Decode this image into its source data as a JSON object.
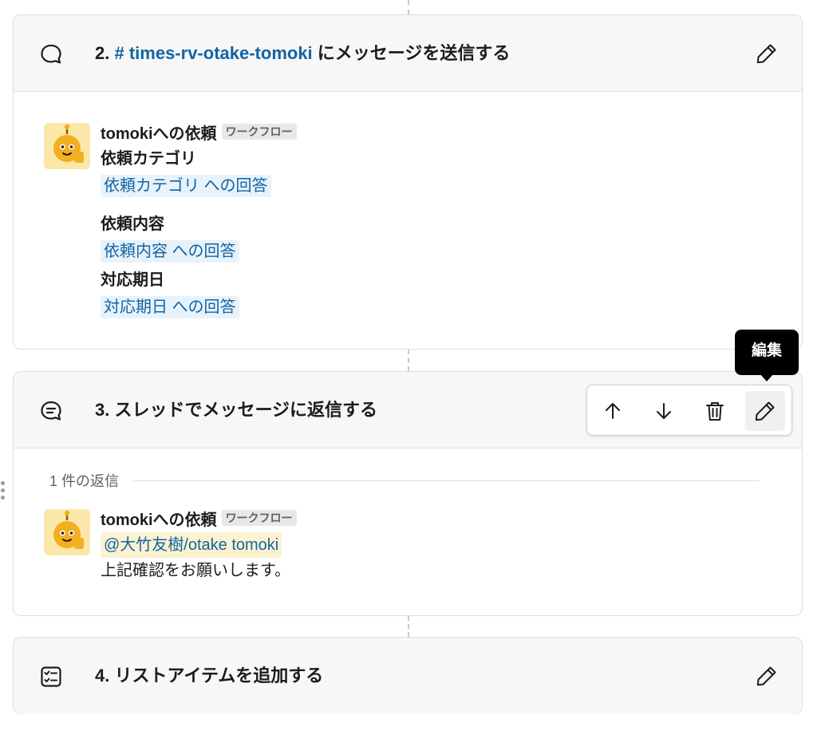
{
  "steps": [
    {
      "number": "2.",
      "channel": "# times-rv-otake-tomoki",
      "title_suffix": "にメッセージを送信する",
      "icon": "chat-bubble-icon",
      "message": {
        "sender": "tomokiへの依頼",
        "badge": "ワークフロー",
        "fields": [
          {
            "label": "依頼カテゴリ",
            "value": "依頼カテゴリ への回答"
          },
          {
            "label": "依頼内容",
            "value": "依頼内容 への回答"
          },
          {
            "label": "対応期日",
            "value": "対応期日 への回答"
          }
        ]
      }
    },
    {
      "number": "3.",
      "title": "スレッドでメッセージに返信する",
      "icon": "thread-reply-icon",
      "reply_count": "1 件の返信",
      "message": {
        "sender": "tomokiへの依頼",
        "badge": "ワークフロー",
        "mention": "@大竹友樹/otake tomoki",
        "text": "上記確認をお願いします。"
      },
      "toolbar": {
        "icons": [
          "arrow-up-icon",
          "arrow-down-icon",
          "trash-icon",
          "pencil-icon"
        ],
        "tooltip": "編集"
      }
    },
    {
      "number": "4.",
      "title": "リストアイテムを追加する",
      "icon": "checklist-icon"
    }
  ],
  "colors": {
    "link": "#1264a3",
    "header_bg": "#f7f7f7",
    "var_chip_bg": "#e8f2fa",
    "mention_bg": "#fdf2d0",
    "avatar_bg": "#fbe7a8",
    "robot": "#f2b01e"
  }
}
